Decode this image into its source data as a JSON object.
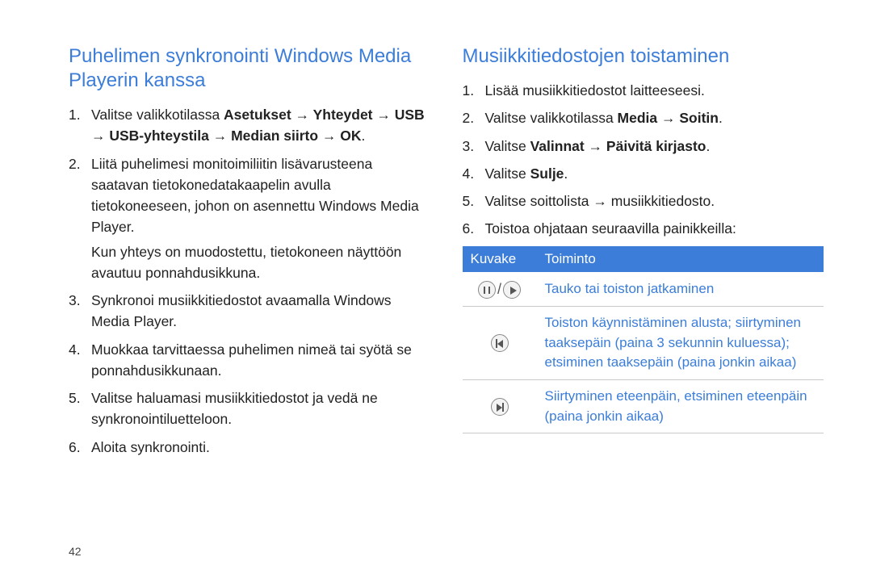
{
  "left": {
    "heading": "Puhelimen synkronointi Windows Media Playerin kanssa",
    "items": [
      {
        "pre": "Valitse valikkotilassa ",
        "bold": "Asetukset → Yhteydet → USB → USB-yhteystila → Median siirto → OK",
        "post": "."
      },
      {
        "text": "Liitä puhelimesi monitoimiliitin lisävarusteena saatavan tietokonedatakaapelin avulla tietokoneeseen, johon on asennettu Windows Media Player.",
        "sub": "Kun yhteys on muodostettu, tietokoneen näyttöön avautuu ponnahdusikkuna."
      },
      {
        "text": "Synkronoi musiikkitiedostot avaamalla Windows Media Player."
      },
      {
        "text": "Muokkaa tarvittaessa puhelimen nimeä tai syötä se ponnahdusikkunaan."
      },
      {
        "text": "Valitse haluamasi musiikkitiedostot ja vedä ne synkronointiluetteloon."
      },
      {
        "text": "Aloita synkronointi."
      }
    ]
  },
  "right": {
    "heading": "Musiikkitiedostojen toistaminen",
    "items": [
      {
        "text": "Lisää musiikkitiedostot laitteeseesi."
      },
      {
        "pre": "Valitse valikkotilassa ",
        "bold": "Media → Soitin",
        "post": "."
      },
      {
        "pre": "Valitse ",
        "bold": "Valinnat → Päivitä kirjasto",
        "post": "."
      },
      {
        "pre": "Valitse ",
        "bold": "Sulje",
        "post": "."
      },
      {
        "text": "Valitse soittolista → musiikkitiedosto."
      },
      {
        "text": "Toistoa ohjataan seuraavilla painikkeilla:"
      }
    ],
    "table": {
      "head": [
        "Kuvake",
        "Toiminto"
      ],
      "rows": [
        {
          "icon": "pause-play",
          "func": "Tauko tai toiston jatkaminen"
        },
        {
          "icon": "prev",
          "func": "Toiston käynnistäminen alusta; siirtyminen taaksepäin (paina 3 sekunnin kuluessa); etsiminen taaksepäin (paina jonkin aikaa)"
        },
        {
          "icon": "next",
          "func": "Siirtyminen eteenpäin, etsiminen eteenpäin (paina jonkin aikaa)"
        }
      ]
    }
  },
  "page_number": "42"
}
